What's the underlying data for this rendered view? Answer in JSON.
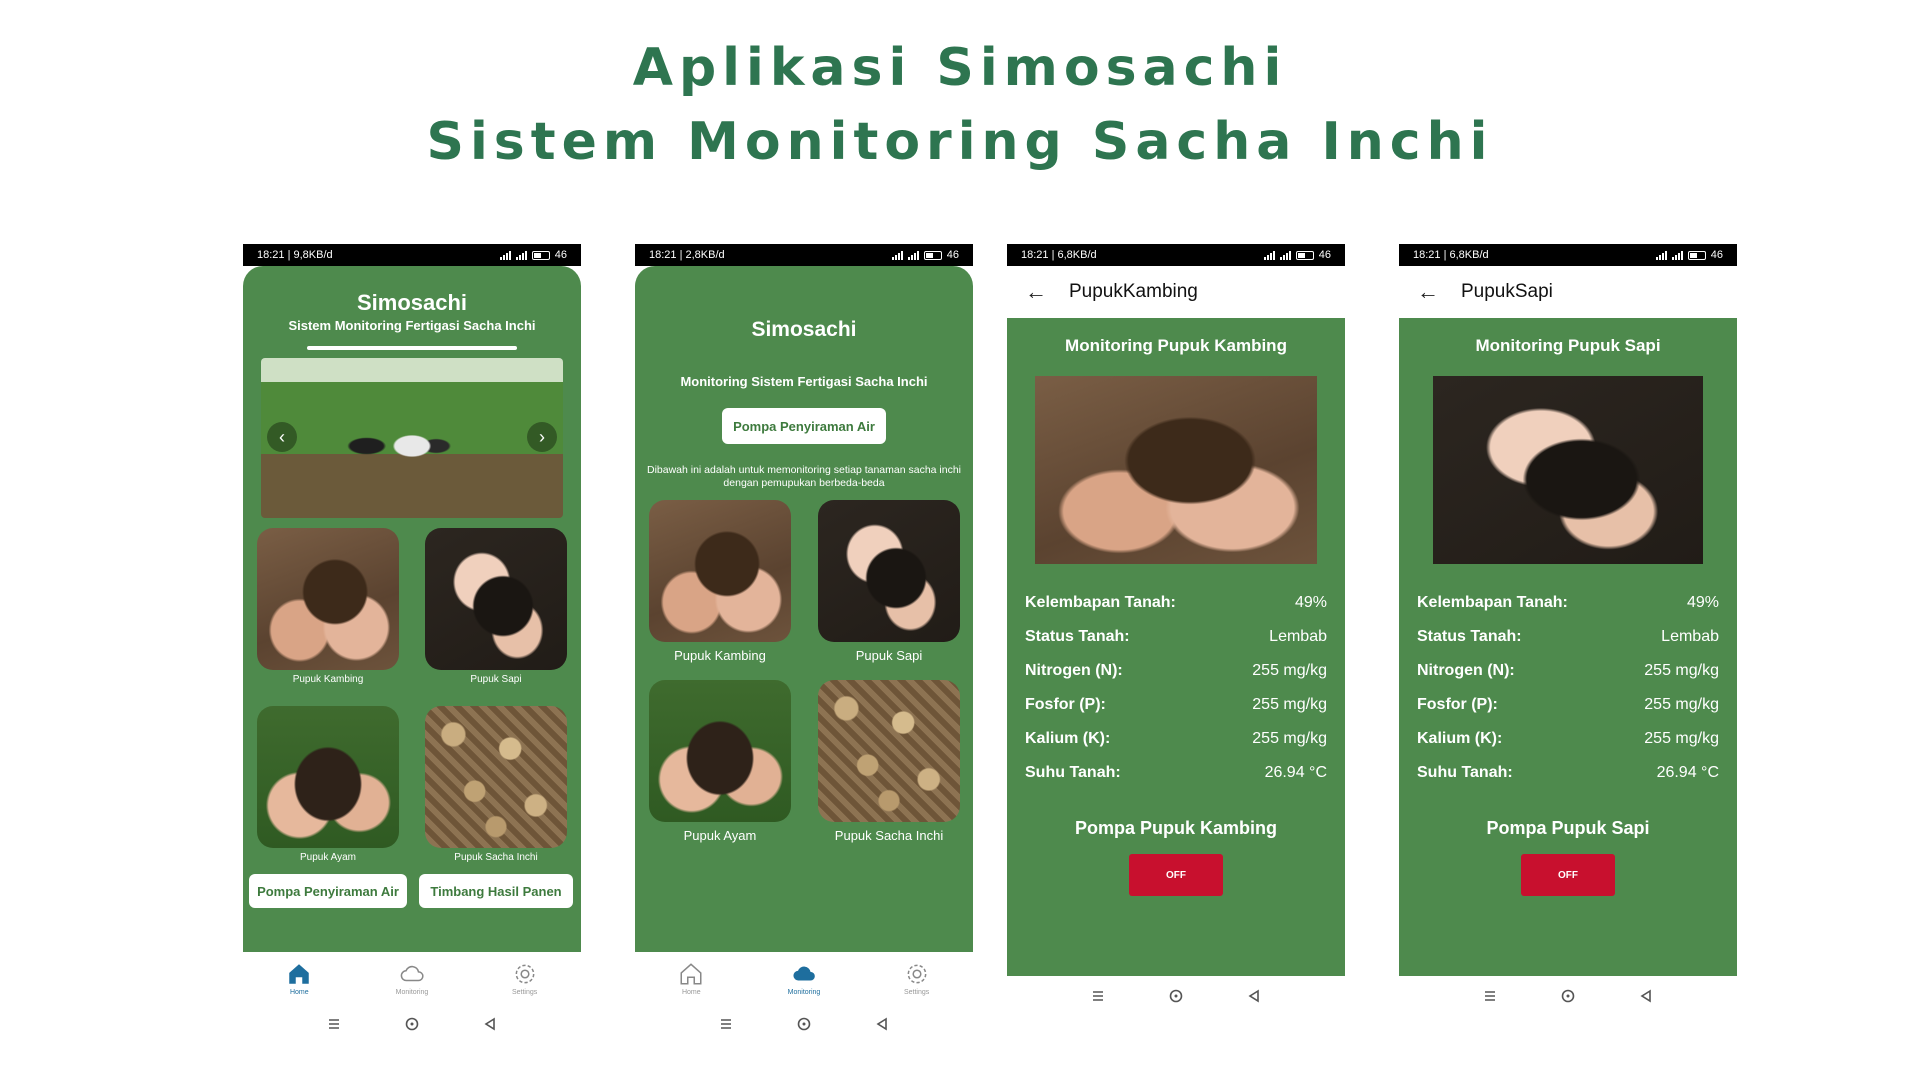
{
  "page": {
    "title_line1": "Aplikasi Simosachi",
    "title_line2": "Sistem Monitoring Sacha Inchi"
  },
  "colors": {
    "green": "#4e8a4d",
    "title_green": "#2e7550",
    "off_red": "#c8102e",
    "active_blue": "#1e6e9e"
  },
  "nav": {
    "home": "Home",
    "monitoring": "Monitoring",
    "settings": "Settings"
  },
  "phone1": {
    "status_left": "18:21 | 9,8KB/d",
    "battery": "46",
    "app_title": "Simosachi",
    "subtitle": "Sistem Monitoring Fertigasi Sacha Inchi",
    "cards": [
      "Pupuk Kambing",
      "Pupuk Sapi",
      "Pupuk Ayam",
      "Pupuk Sacha Inchi"
    ],
    "btn_left": "Pompa Penyiraman Air",
    "btn_right": "Timbang Hasil Panen"
  },
  "phone2": {
    "status_left": "18:21 | 2,8KB/d",
    "battery": "46",
    "app_title": "Simosachi",
    "subtitle": "Monitoring Sistem Fertigasi Sacha Inchi",
    "pump_button": "Pompa Penyiraman Air",
    "description": "Dibawah ini adalah untuk memonitoring setiap tanaman sacha inchi dengan pemupukan berbeda-beda",
    "cards": [
      "Pupuk Kambing",
      "Pupuk Sapi",
      "Pupuk Ayam",
      "Pupuk Sacha Inchi"
    ]
  },
  "phone3": {
    "status_left": "18:21 | 6,8KB/d",
    "battery": "46",
    "topbar_title": "PupukKambing",
    "heading": "Monitoring Pupuk Kambing",
    "rows": [
      {
        "k": "Kelembapan Tanah:",
        "v": "49%"
      },
      {
        "k": "Status Tanah:",
        "v": "Lembab"
      },
      {
        "k": "Nitrogen (N):",
        "v": "255 mg/kg"
      },
      {
        "k": "Fosfor (P):",
        "v": "255 mg/kg"
      },
      {
        "k": "Kalium (K):",
        "v": "255 mg/kg"
      },
      {
        "k": "Suhu Tanah:",
        "v": "26.94 °C"
      }
    ],
    "pompa": "Pompa Pupuk Kambing",
    "off": "OFF"
  },
  "phone4": {
    "status_left": "18:21 | 6,8KB/d",
    "battery": "46",
    "topbar_title": "PupukSapi",
    "heading": "Monitoring Pupuk Sapi",
    "rows": [
      {
        "k": "Kelembapan Tanah:",
        "v": "49%"
      },
      {
        "k": "Status Tanah:",
        "v": "Lembab"
      },
      {
        "k": "Nitrogen (N):",
        "v": "255 mg/kg"
      },
      {
        "k": "Fosfor (P):",
        "v": "255 mg/kg"
      },
      {
        "k": "Kalium (K):",
        "v": "255 mg/kg"
      },
      {
        "k": "Suhu Tanah:",
        "v": "26.94 °C"
      }
    ],
    "pompa": "Pompa Pupuk Sapi",
    "off": "OFF"
  }
}
